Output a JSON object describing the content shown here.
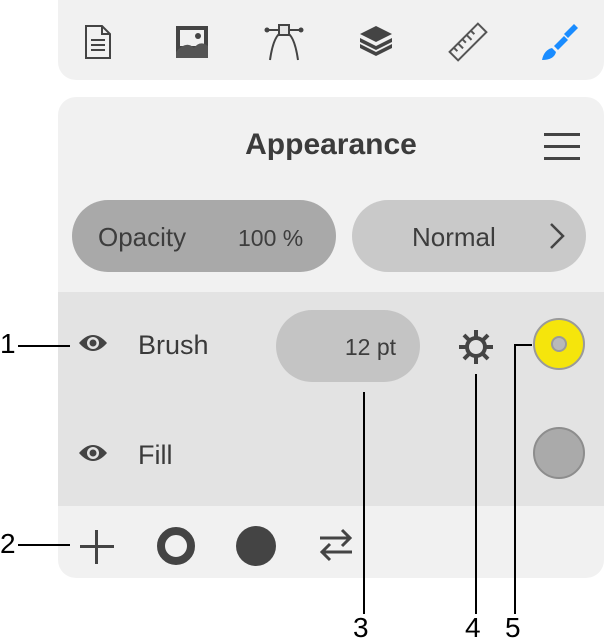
{
  "toolbar": {
    "icons": [
      "document-icon",
      "image-icon",
      "bezier-path-icon",
      "layers-icon",
      "ruler-icon",
      "brush-icon"
    ],
    "active_icon": "brush-icon",
    "accent_color": "#1a8cff"
  },
  "panel": {
    "title": "Appearance",
    "opacity_label": "Opacity",
    "opacity_value": "100 %",
    "blend_mode": "Normal"
  },
  "layers": [
    {
      "label": "Brush",
      "visible": true,
      "size": "12 pt",
      "color": "#f5e50c"
    },
    {
      "label": "Fill",
      "visible": true,
      "color": "#aaaaaa"
    }
  ],
  "bottom_bar": {
    "icons": [
      "add-icon",
      "stroke-circle-icon",
      "filled-circle-icon",
      "swap-icon"
    ]
  },
  "callouts": [
    "1",
    "2",
    "3",
    "4",
    "5"
  ]
}
